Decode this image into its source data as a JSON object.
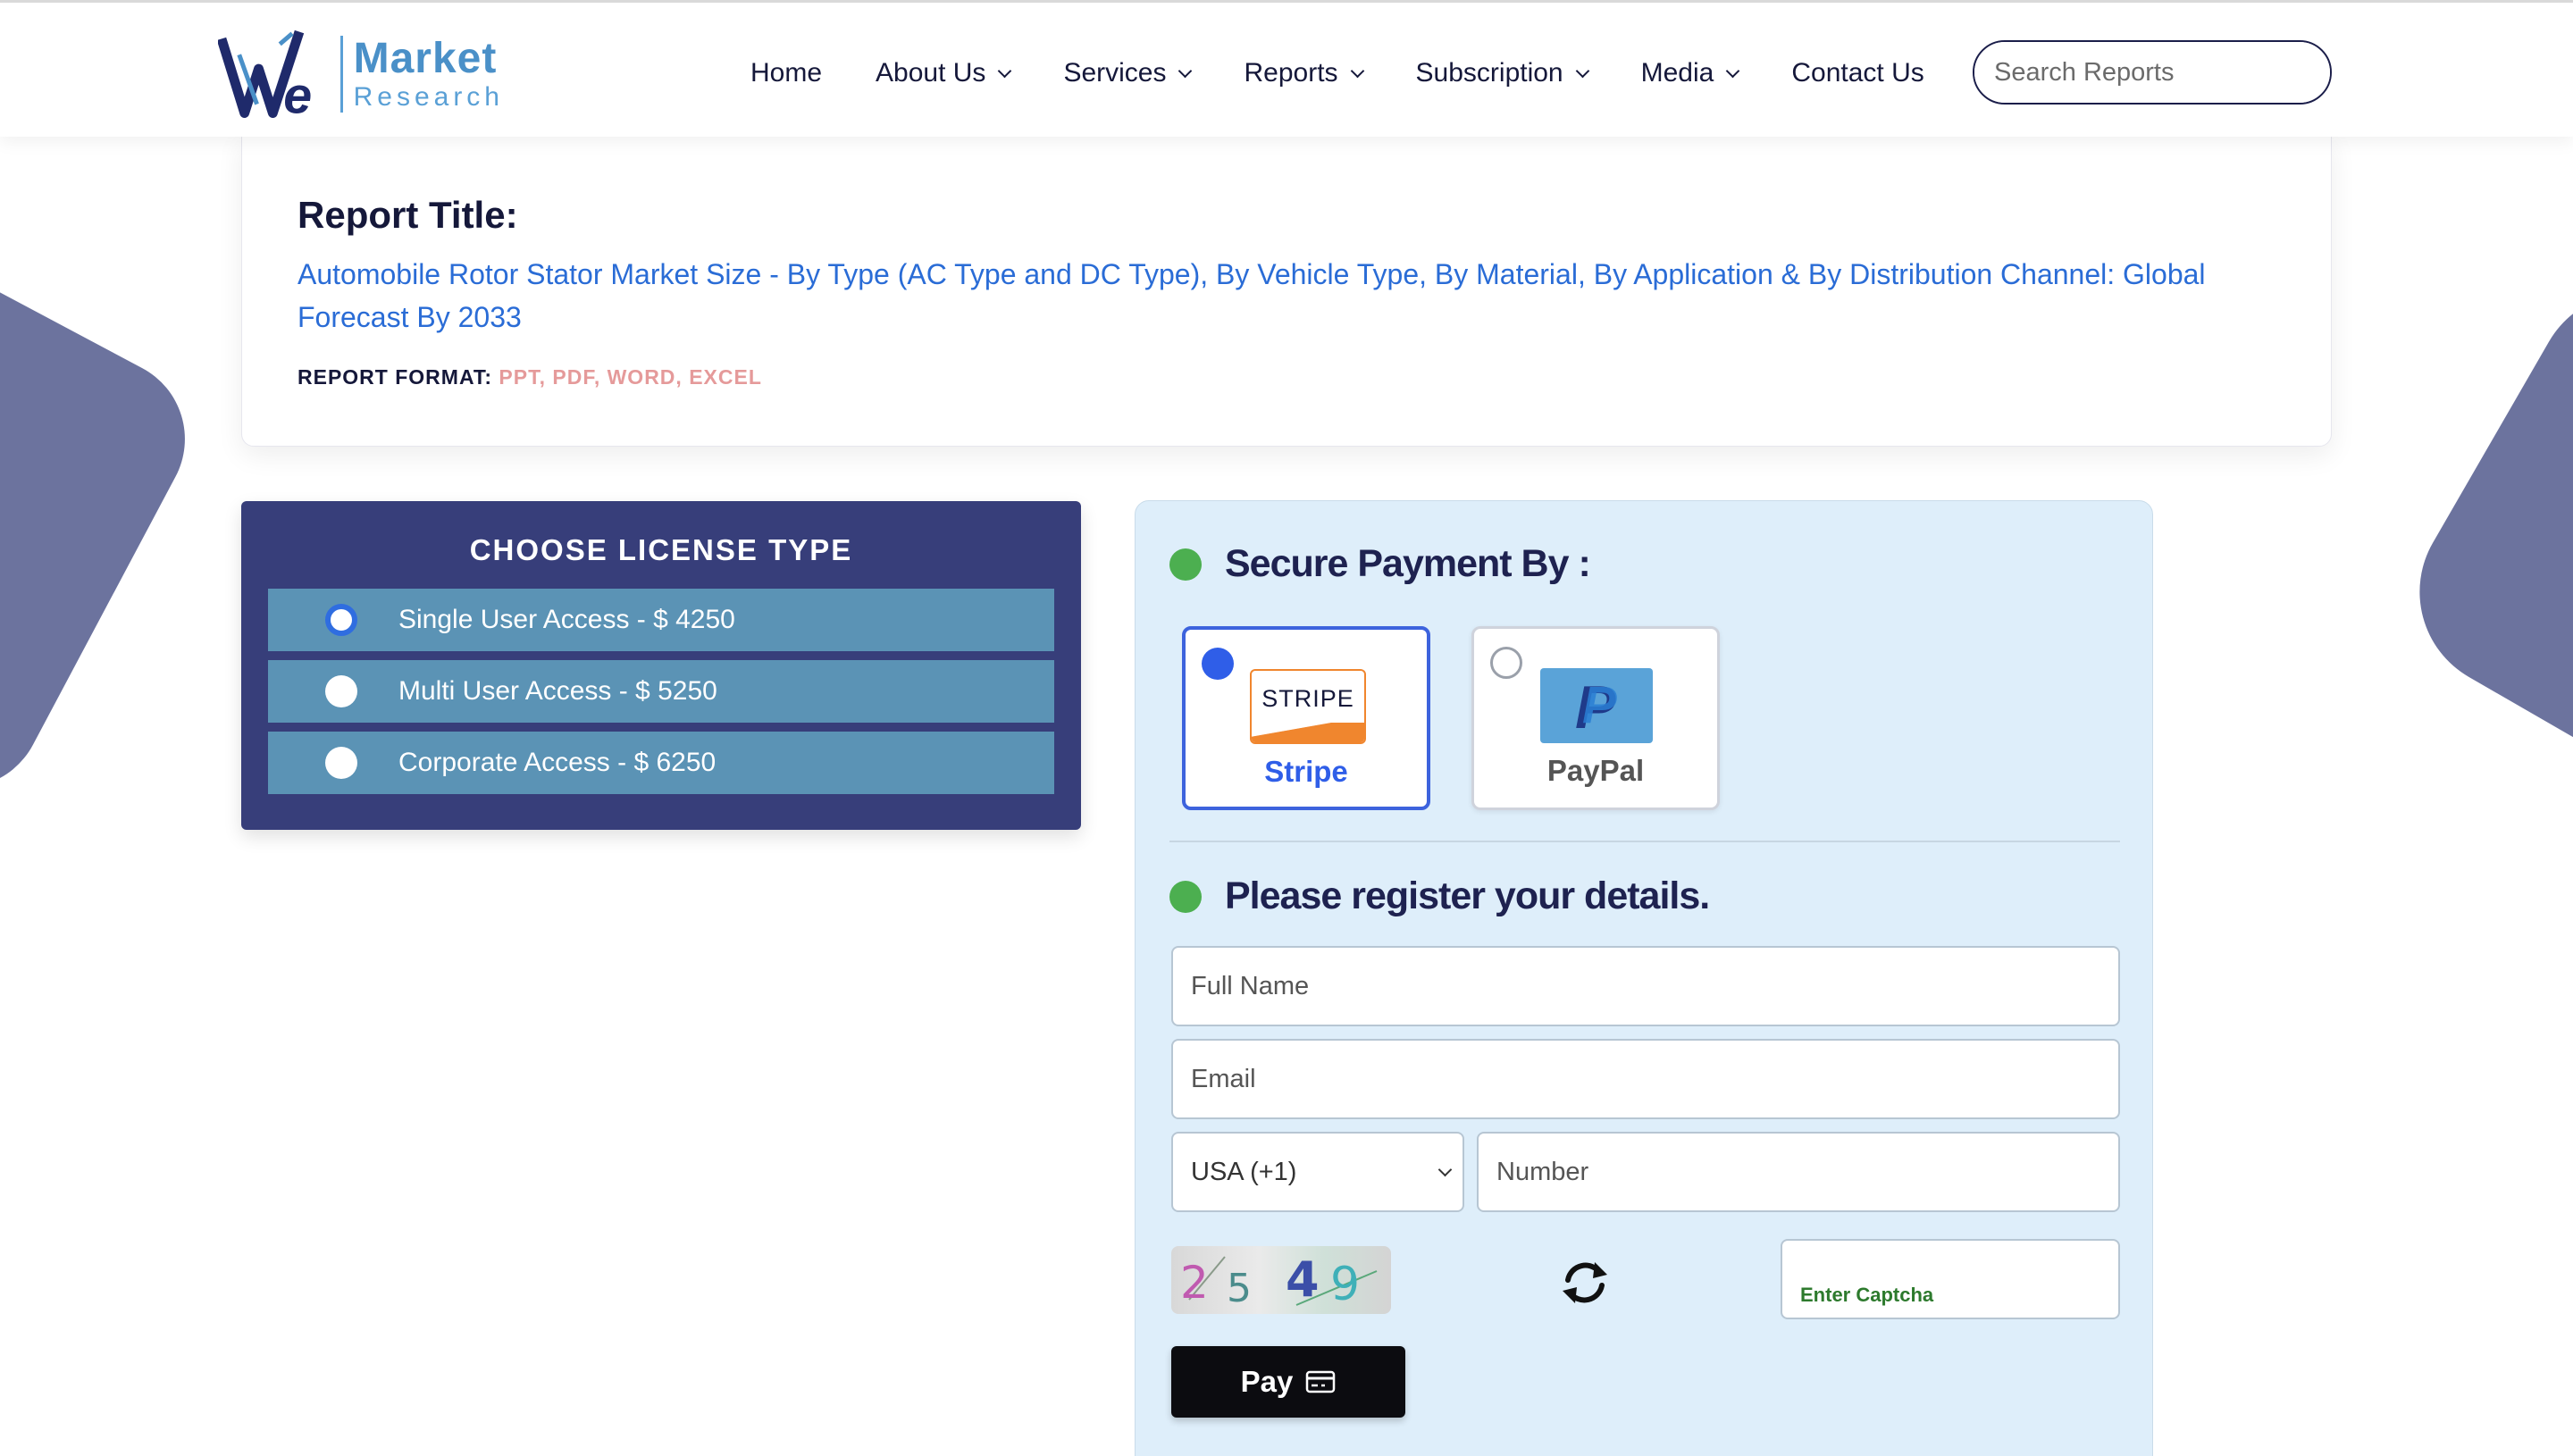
{
  "header": {
    "logo": {
      "brand_mark": "We",
      "name_line1": "Market",
      "name_line2": "Research"
    },
    "nav": [
      {
        "label": "Home",
        "has_dropdown": false
      },
      {
        "label": "About Us",
        "has_dropdown": true
      },
      {
        "label": "Services",
        "has_dropdown": true
      },
      {
        "label": "Reports",
        "has_dropdown": true
      },
      {
        "label": "Subscription",
        "has_dropdown": true
      },
      {
        "label": "Media",
        "has_dropdown": true
      },
      {
        "label": "Contact Us",
        "has_dropdown": false
      }
    ],
    "search": {
      "placeholder": "Search Reports",
      "icon": "search-icon"
    }
  },
  "report": {
    "label": "Report Title:",
    "title": "Automobile Rotor Stator Market Size - By Type (AC Type and DC Type), By Vehicle Type, By Material, By Application & By Distribution Channel: Global Forecast By 2033",
    "format_label": "REPORT FORMAT:",
    "formats": "PPT, PDF, WORD, EXCEL"
  },
  "license": {
    "title": "CHOOSE LICENSE TYPE",
    "options": [
      {
        "label": "Single User Access - $ 4250",
        "selected": true
      },
      {
        "label": "Multi User Access - $ 5250",
        "selected": false
      },
      {
        "label": "Corporate Access - $ 6250",
        "selected": false
      }
    ]
  },
  "payment": {
    "heading": "Secure Payment By :",
    "gateways": [
      {
        "name": "Stripe",
        "logo_text": "STRIPE",
        "selected": true
      },
      {
        "name": "PayPal",
        "logo_text": "P",
        "selected": false
      }
    ],
    "register_heading": "Please register your details.",
    "fields": {
      "full_name_placeholder": "Full Name",
      "email_placeholder": "Email",
      "country_code": "USA (+1)",
      "number_placeholder": "Number",
      "captcha_placeholder": "Enter Captcha"
    },
    "captcha_chars": [
      "2",
      "5",
      "4",
      "9"
    ],
    "pay_label": "Pay"
  },
  "colors": {
    "navy": "#373e7a",
    "option_bg": "#5b93b5",
    "link_blue": "#2a6cd6",
    "panel_bg": "#deeefa",
    "status_green": "#4caf50",
    "stripe_orange": "#f0862e",
    "format_pink": "#e59a9a"
  }
}
